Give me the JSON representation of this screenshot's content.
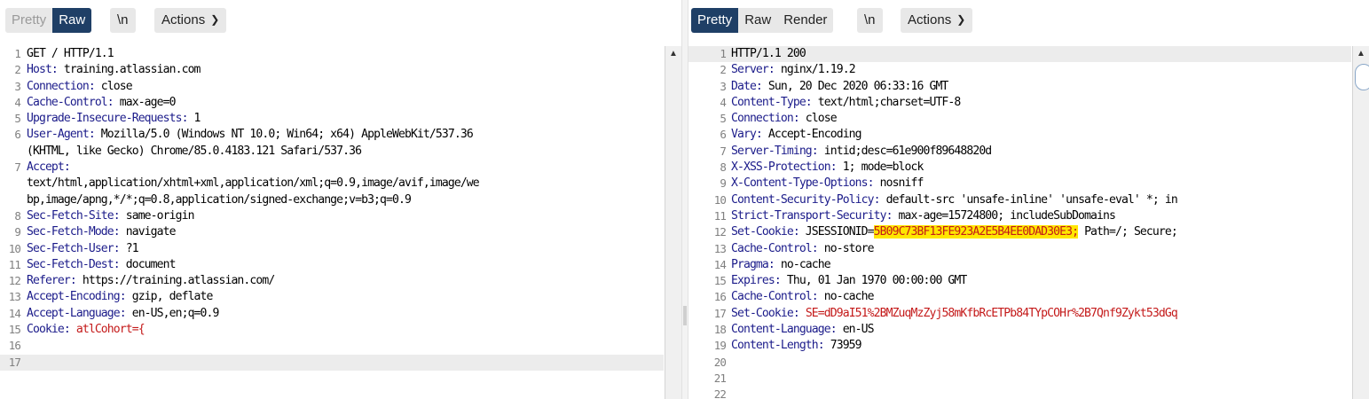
{
  "request": {
    "toolbar": {
      "pretty": "Pretty",
      "raw": "Raw",
      "newline": "\\n",
      "actions": "Actions"
    },
    "lines": [
      {
        "n": "1",
        "t": "GET / HTTP/1.1"
      },
      {
        "n": "2",
        "k": "Host:",
        "v": " training.atlassian.com"
      },
      {
        "n": "3",
        "k": "Connection:",
        "v": " close"
      },
      {
        "n": "4",
        "k": "Cache-Control:",
        "v": " max-age=0"
      },
      {
        "n": "5",
        "k": "Upgrade-Insecure-Requests:",
        "v": " 1"
      },
      {
        "n": "6",
        "k": "User-Agent:",
        "v": " Mozilla/5.0 (Windows NT 10.0; Win64; x64) AppleWebKit/537.36"
      },
      {
        "n": "",
        "t": "(KHTML, like Gecko) Chrome/85.0.4183.121 Safari/537.36"
      },
      {
        "n": "7",
        "k": "Accept:",
        "v": ""
      },
      {
        "n": "",
        "t": "text/html,application/xhtml+xml,application/xml;q=0.9,image/avif,image/we"
      },
      {
        "n": "",
        "t": "bp,image/apng,*/*;q=0.8,application/signed-exchange;v=b3;q=0.9"
      },
      {
        "n": "8",
        "k": "Sec-Fetch-Site:",
        "v": " same-origin"
      },
      {
        "n": "9",
        "k": "Sec-Fetch-Mode:",
        "v": " navigate"
      },
      {
        "n": "10",
        "k": "Sec-Fetch-User:",
        "v": " ?1"
      },
      {
        "n": "11",
        "k": "Sec-Fetch-Dest:",
        "v": " document"
      },
      {
        "n": "12",
        "k": "Referer:",
        "v": " https://training.atlassian.com/"
      },
      {
        "n": "13",
        "k": "Accept-Encoding:",
        "v": " gzip, deflate"
      },
      {
        "n": "14",
        "k": "Accept-Language:",
        "v": " en-US,en;q=0.9"
      },
      {
        "n": "15",
        "k": "Cookie:",
        "v": " ",
        "r": "atlCohort={"
      },
      {
        "n": "16",
        "t": ""
      },
      {
        "n": "17",
        "t": ""
      }
    ]
  },
  "response": {
    "toolbar": {
      "pretty": "Pretty",
      "raw": "Raw",
      "render": "Render",
      "newline": "\\n",
      "actions": "Actions"
    },
    "lines": [
      {
        "n": "1",
        "t": "HTTP/1.1 200"
      },
      {
        "n": "2",
        "k": "Server:",
        "v": " nginx/1.19.2"
      },
      {
        "n": "3",
        "k": "Date:",
        "v": " Sun, 20 Dec 2020 06:33:16 GMT"
      },
      {
        "n": "4",
        "k": "Content-Type:",
        "v": " text/html;charset=UTF-8"
      },
      {
        "n": "5",
        "k": "Connection:",
        "v": " close"
      },
      {
        "n": "6",
        "k": "Vary:",
        "v": " Accept-Encoding"
      },
      {
        "n": "7",
        "k": "Server-Timing:",
        "v": " intid;desc=61e900f89648820d"
      },
      {
        "n": "8",
        "k": "X-XSS-Protection:",
        "v": " 1; mode=block"
      },
      {
        "n": "9",
        "k": "X-Content-Type-Options:",
        "v": " nosniff"
      },
      {
        "n": "10",
        "k": "Content-Security-Policy:",
        "v": " default-src 'unsafe-inline' 'unsafe-eval' *; in"
      },
      {
        "n": "11",
        "k": "Strict-Transport-Security:",
        "v": " max-age=15724800; includeSubDomains"
      },
      {
        "n": "12",
        "k": "Set-Cookie:",
        "v": " JSESSIONID=",
        "h": "5B09C73BF13FE923A2E5B4EE0DAD30E3;",
        "v2": " Path=/; Secure;"
      },
      {
        "n": "13",
        "k": "Cache-Control:",
        "v": " no-store"
      },
      {
        "n": "14",
        "k": "Pragma:",
        "v": " no-cache"
      },
      {
        "n": "15",
        "k": "Expires:",
        "v": " Thu, 01 Jan 1970 00:00:00 GMT"
      },
      {
        "n": "16",
        "k": "Cache-Control:",
        "v": " no-cache"
      },
      {
        "n": "17",
        "k": "Set-Cookie:",
        "v": " ",
        "r": "SE=dD9aI51%2BMZuqMzZyj58mKfbRcETPb84TYpCOHr%2B7Qnf9Zykt53dGq"
      },
      {
        "n": "18",
        "k": "Content-Language:",
        "v": " en-US"
      },
      {
        "n": "19",
        "k": "Content-Length:",
        "v": " 73959"
      },
      {
        "n": "20",
        "t": ""
      },
      {
        "n": "21",
        "t": ""
      },
      {
        "n": "22",
        "t": ""
      }
    ]
  },
  "colors": {
    "active_tab": "#1f3f66",
    "header_key": "#1b1b8a",
    "highlight": "#ffe600",
    "cookie_value": "#c41a1a"
  }
}
